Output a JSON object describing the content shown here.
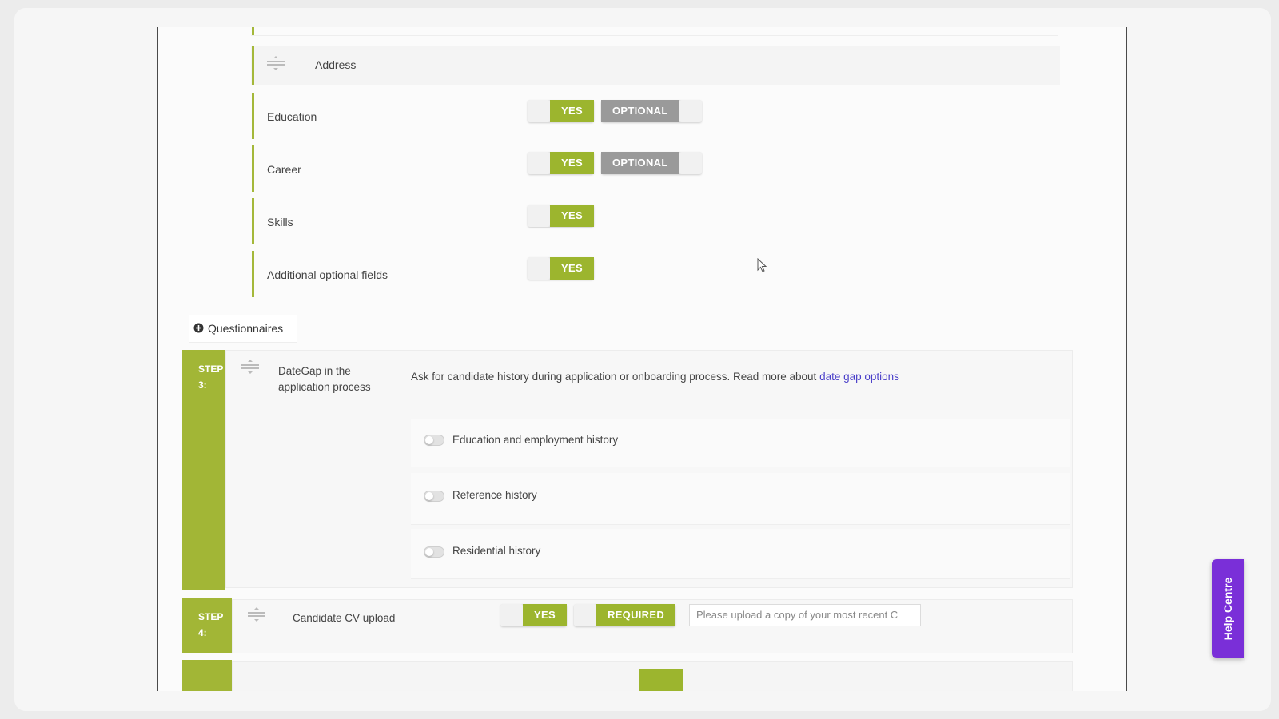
{
  "fields": [
    {
      "label": "Address"
    },
    {
      "label": "Education",
      "toggle": "YES",
      "mode": "OPTIONAL"
    },
    {
      "label": "Career",
      "toggle": "YES",
      "mode": "OPTIONAL"
    },
    {
      "label": "Skills",
      "toggle": "YES"
    },
    {
      "label": "Additional optional fields",
      "toggle": "YES"
    }
  ],
  "questionnaires": {
    "label": "Questionnaires"
  },
  "step3": {
    "tab": "STEP 3:",
    "title": "DateGap in the application process",
    "description": "Ask for candidate history during application or onboarding process. Read more about",
    "link": "date gap options",
    "options": [
      {
        "label": "Education and employment history"
      },
      {
        "label": "Reference history"
      },
      {
        "label": "Residential history"
      }
    ]
  },
  "step4": {
    "tab": "STEP 4:",
    "title": "Candidate CV upload",
    "toggle": "YES",
    "mode": "REQUIRED",
    "hint": "Please upload a copy of your most recent C"
  },
  "help": {
    "label": "Help Centre"
  },
  "colors": {
    "green": "#a2b636",
    "purple": "#7a2fd8",
    "link": "#4a3fc9"
  }
}
